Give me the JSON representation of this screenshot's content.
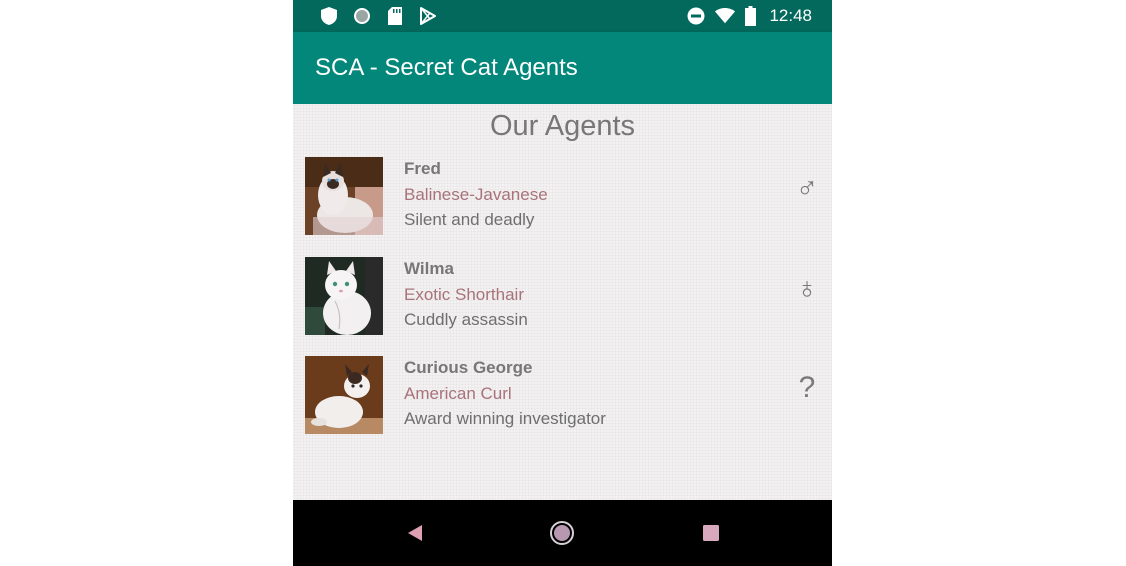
{
  "status_bar": {
    "time": "12:48",
    "left_icons": [
      "shield-icon",
      "circle-dot-icon",
      "sd-card-icon",
      "play-store-icon"
    ],
    "right_icons": [
      "do-not-disturb-icon",
      "wifi-icon",
      "battery-icon"
    ]
  },
  "app_bar": {
    "title": "SCA - Secret Cat Agents",
    "background": "#03877a"
  },
  "main": {
    "heading": "Our Agents",
    "agents": [
      {
        "name": "Fred",
        "breed": "Balinese-Javanese",
        "description": "Silent and deadly",
        "gender_symbol": "♂",
        "gender_icon": "male-icon"
      },
      {
        "name": "Wilma",
        "breed": "Exotic Shorthair",
        "description": "Cuddly assassin",
        "gender_symbol": "♁",
        "gender_icon": "female-icon"
      },
      {
        "name": "Curious George",
        "breed": "American Curl",
        "description": "Award winning investigator",
        "gender_symbol": "?",
        "gender_icon": "unknown-gender-icon"
      }
    ]
  },
  "nav_bar": {
    "buttons": [
      "back-icon",
      "home-icon",
      "recents-icon"
    ]
  },
  "colors": {
    "status_bar": "#02695c",
    "accent": "#03877a",
    "breed_text": "#a8737a"
  }
}
